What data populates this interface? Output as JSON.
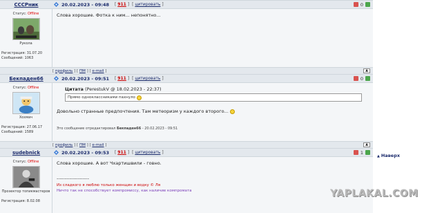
{
  "posts": [
    {
      "author": "СССРник",
      "date": "20.02.2023 - 09:48",
      "post_num": "911",
      "cite": "цитировать",
      "rating": "0",
      "status_label": "Статус:",
      "status": "Offline",
      "avatar_caption": "Рукола",
      "reg_label": "Регистрация: 31.07.20",
      "msg_label": "Сообщений: 1063",
      "text": "Слова хорошие. Фотка к ним... непонятно..."
    },
    {
      "author": "Бекпаден66",
      "date": "20.02.2023 - 09:51",
      "post_num": "911",
      "cite": "цитировать",
      "rating": "0",
      "status_label": "Статус:",
      "status": "Offline",
      "avatar_caption": "Хохмач",
      "reg_label": "Регистрация: 27.06.17",
      "msg_label": "Сообщений: 1589",
      "quote_title": "Цитата",
      "quote_meta": "(PerestukV @ 18.02.2023 - 22:37)",
      "quote_text": "Прямо одноклассниками пахнуло",
      "text": "Довольно странные предпочтения. Там метеоризм у каждого второго...",
      "edited_prefix": "Это сообщение отредактировал",
      "edited_author": "Бекпаден66",
      "edited_suffix": "- 20.02.2023 - 09:51"
    },
    {
      "author": "sudebnick",
      "date": "20.02.2023 - 09:53",
      "post_num": "911",
      "cite": "цитировать",
      "rating": "1",
      "status_label": "Статус:",
      "status": "Offline",
      "avatar_caption": "Прозектор топикмастеров",
      "reg_label": "Регистрация: 8.02.08",
      "text": "Слова хорошие. А вот Чхартишвили - говно.",
      "sig_line": "--------------------",
      "sig1": "Из сладкого я люблю только женщин и водку © Ля",
      "sig2": "Ничто так не способствует компромиссу, как наличие компромата"
    }
  ],
  "footer_links": {
    "profile": "профиль",
    "pm": "ПМ",
    "email": "e-mail"
  },
  "naverh": "Наверх",
  "watermark": "YAPLAKAL.COM"
}
